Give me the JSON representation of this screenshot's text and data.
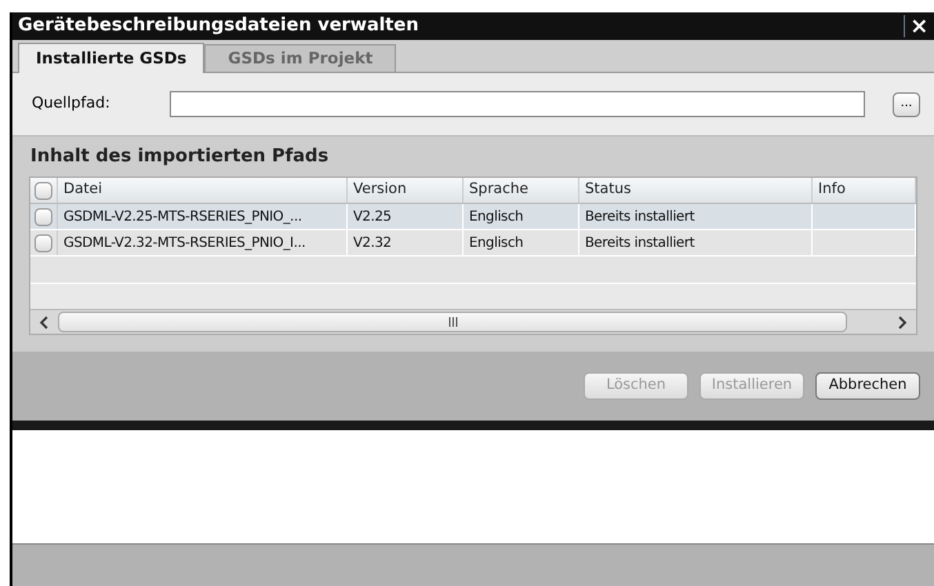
{
  "window": {
    "title": "Gerätebeschreibungsdateien verwalten",
    "close": "×"
  },
  "tabs": [
    {
      "label": "Installierte GSDs",
      "selected": true
    },
    {
      "label": "GSDs im Projekt",
      "selected": false
    }
  ],
  "source": {
    "label": "Quellpfad:",
    "browse": "..."
  },
  "section": {
    "title": "Inhalt des importierten Pfads"
  },
  "table": {
    "header_checked": false,
    "columns": [
      "Datei",
      "Version",
      "Sprache",
      "Status",
      "Info"
    ],
    "rows": [
      {
        "checked": false,
        "selected": true,
        "cells": [
          "GSDML-V2.25-MTS-RSERIES_PNIO_...",
          "V2.25",
          "Englisch",
          "Bereits installiert"
        ]
      },
      {
        "checked": false,
        "selected": false,
        "cells": [
          "GSDML-V2.32-MTS-RSERIES_PNIO_I...",
          "V2.32",
          "Englisch",
          "Bereits installiert"
        ]
      }
    ]
  },
  "buttons": [
    {
      "label": "Löschen",
      "disabled": true
    },
    {
      "label": "Installieren",
      "disabled": true
    },
    {
      "label": "Abbrechen",
      "disabled": false
    }
  ]
}
